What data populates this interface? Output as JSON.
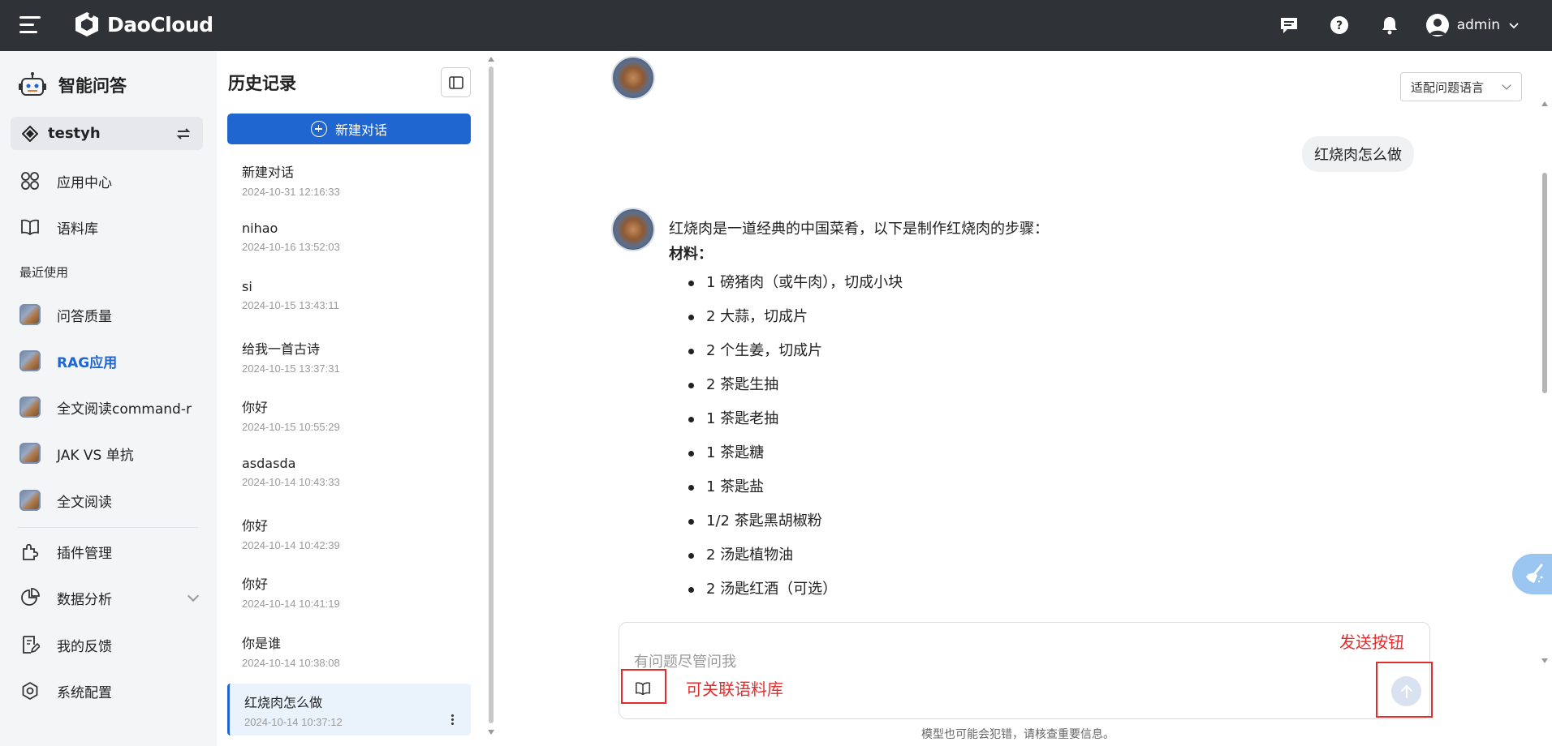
{
  "header": {
    "brand": "DaoCloud",
    "user": "admin",
    "icons": [
      "menu-icon",
      "message-icon",
      "help-icon",
      "bell-icon",
      "user-icon",
      "chevron-down-icon"
    ]
  },
  "sidebar": {
    "title": "智能问答",
    "workspace": "testyh",
    "items_top": [
      {
        "label": "应用中心",
        "icon": "apps-icon"
      },
      {
        "label": "语料库",
        "icon": "book-icon"
      }
    ],
    "recent_label": "最近使用",
    "recent": [
      {
        "label": "问答质量"
      },
      {
        "label": "RAG应用",
        "active": true
      },
      {
        "label": "全文阅读command-r"
      },
      {
        "label": "JAK VS 单抗"
      },
      {
        "label": "全文阅读"
      }
    ],
    "items_bottom": [
      {
        "label": "插件管理",
        "icon": "plugin-icon"
      },
      {
        "label": "数据分析",
        "icon": "pie-chart-icon"
      },
      {
        "label": "我的反馈",
        "icon": "feedback-icon"
      },
      {
        "label": "系统配置",
        "icon": "settings-icon"
      }
    ]
  },
  "history": {
    "title": "历史记录",
    "new_chat": "新建对话",
    "items": [
      {
        "title": "新建对话",
        "date": "2024-10-31 12:16:33"
      },
      {
        "title": "nihao",
        "date": "2024-10-16 13:52:03"
      },
      {
        "title": "si",
        "date": "2024-10-15 13:43:11"
      },
      {
        "title": "给我一首古诗",
        "date": "2024-10-15 13:37:31"
      },
      {
        "title": "你好",
        "date": "2024-10-15 10:55:29"
      },
      {
        "title": "asdasda",
        "date": "2024-10-14 10:43:33"
      },
      {
        "title": "你好",
        "date": "2024-10-14 10:42:39"
      },
      {
        "title": "你好",
        "date": "2024-10-14 10:41:19"
      },
      {
        "title": "你是谁",
        "date": "2024-10-14 10:38:08"
      },
      {
        "title": "红烧肉怎么做",
        "date": "2024-10-14 10:37:12",
        "active": true
      }
    ]
  },
  "chat": {
    "language_select": "适配问题语言",
    "user_message": "红烧肉怎么做",
    "answer_intro": "红烧肉是一道经典的中国菜肴，以下是制作红烧肉的步骤：",
    "answer_heading": "材料：",
    "ingredients": [
      "1 磅猪肉（或牛肉），切成小块",
      "2 大蒜，切成片",
      "2 个生姜，切成片",
      "2 茶匙生抽",
      "1 茶匙老抽",
      "1 茶匙糖",
      "1 茶匙盐",
      "1/2 茶匙黑胡椒粉",
      "2 汤匙植物油",
      "2 汤匙红酒（可选）"
    ],
    "input_placeholder": "有问题尽管问我",
    "annotation_kb": "可关联语料库",
    "annotation_send": "发送按钮",
    "disclaimer": "模型也可能会犯错，请核查重要信息。"
  }
}
